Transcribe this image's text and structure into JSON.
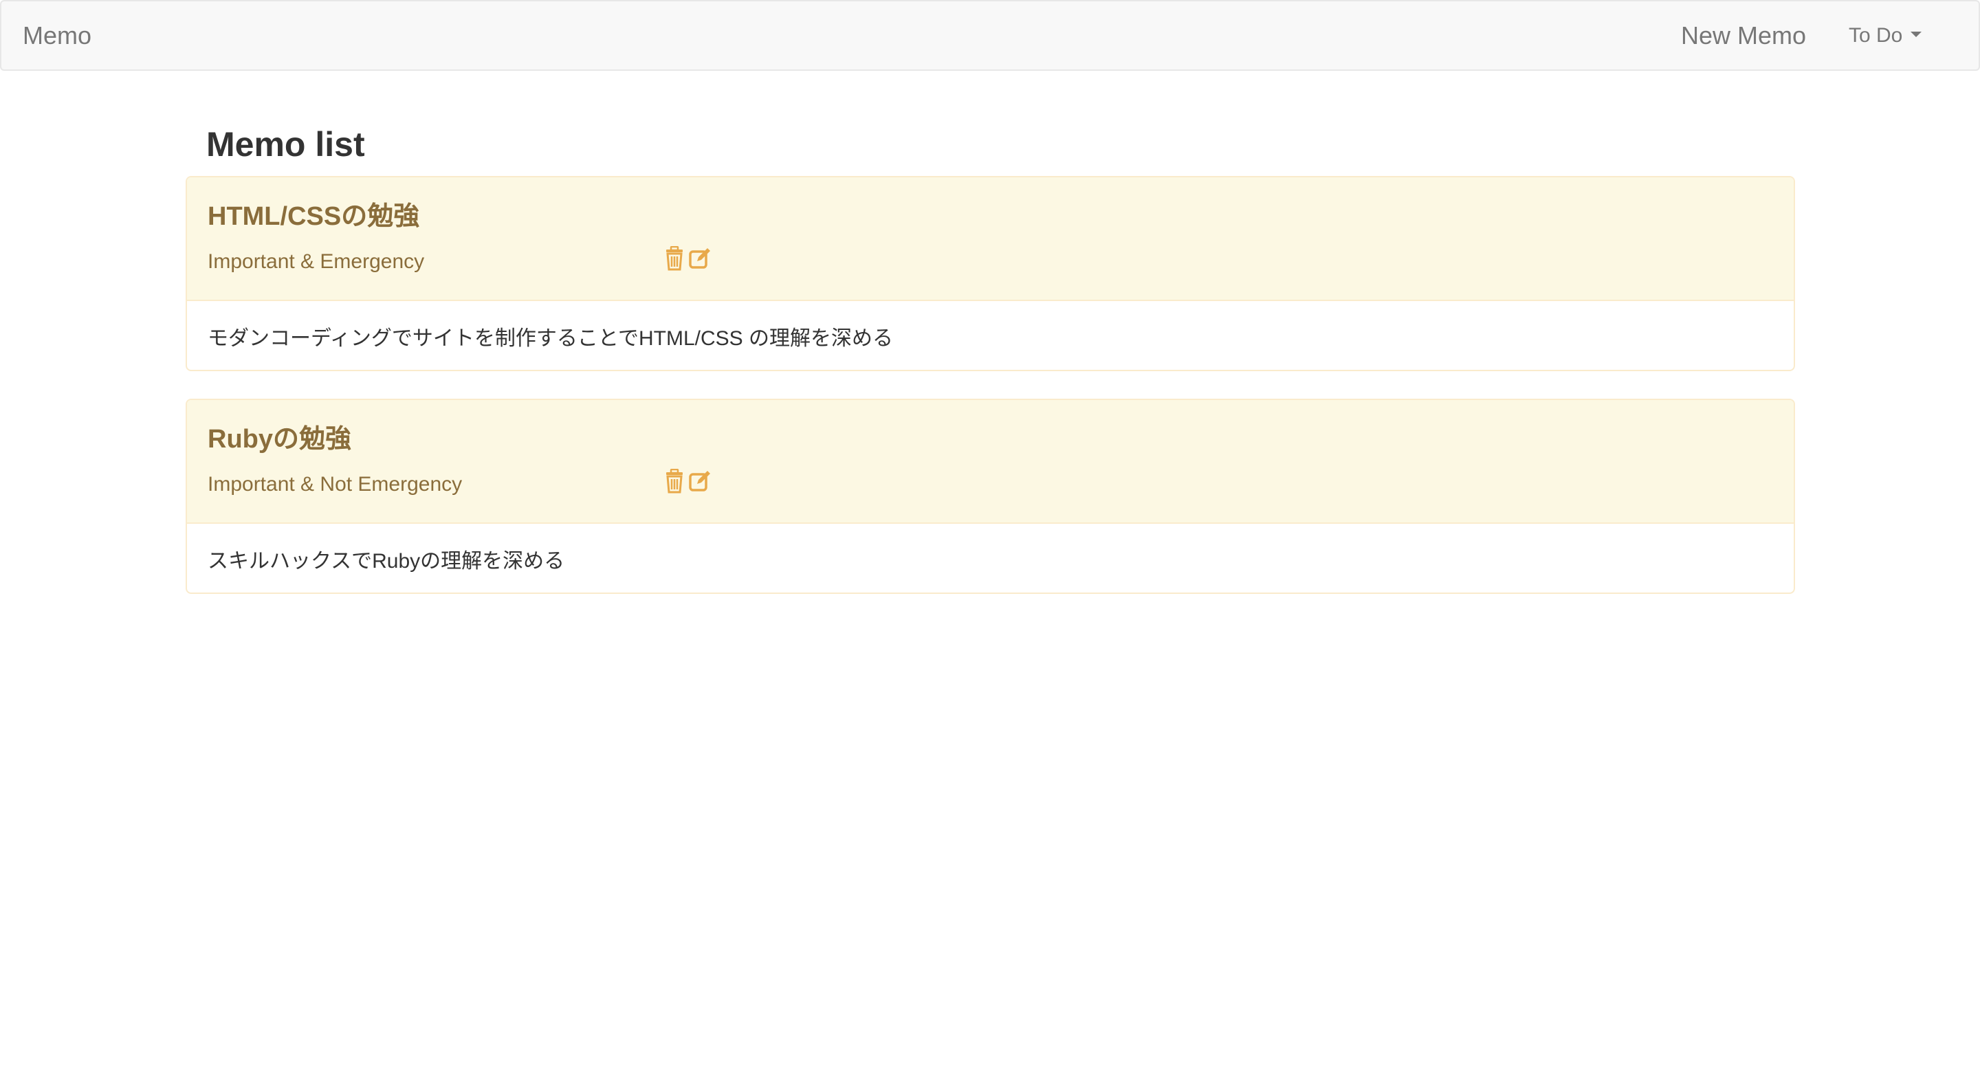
{
  "navbar": {
    "brand": "Memo",
    "new_memo": "New Memo",
    "todo_dropdown": "To Do"
  },
  "page": {
    "title": "Memo list"
  },
  "memos": [
    {
      "title": "HTML/CSSの勉強",
      "category": "Important & Emergency",
      "body": "モダンコーディングでサイトを制作することでHTML/CSS の理解を深める"
    },
    {
      "title": "Rubyの勉強",
      "category": "Important & Not Emergency",
      "body": "スキルハックスでRubyの理解を深める"
    }
  ],
  "icons": {
    "delete": "trash-icon",
    "edit": "edit-icon"
  },
  "colors": {
    "navbar_bg": "#f8f8f8",
    "panel_heading_bg": "#fcf8e3",
    "panel_border": "#faebcc",
    "panel_heading_text": "#8a6d3b",
    "icon_color": "#e8a94a"
  }
}
